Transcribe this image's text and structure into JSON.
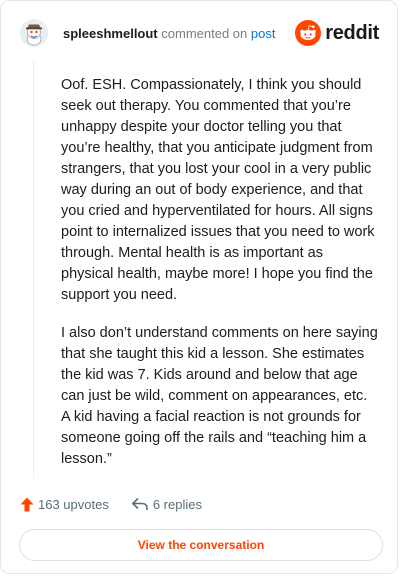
{
  "comment": {
    "username": "spleeshmellout",
    "action_text": "commented on",
    "target_link": "post",
    "paragraphs": [
      "Oof. ESH. Compassionately, I think you should seek out therapy. You commented that you’re unhappy despite your doctor telling you that you’re healthy, that you anticipate judgment from strangers, that you lost your cool in a very public way during an out of body experience, and that you cried and hyperventilated for hours. All signs point to internalized issues that you need to work through. Mental health is as important as physical health, maybe more! I hope you find the support you need.",
      "I also don’t understand comments on here saying that she taught this kid a lesson. She estimates the kid was 7. Kids around and below that age can just be wild, comment on appearances, etc. A kid having a facial reaction is not grounds for someone going off the rails and “teaching him a lesson.”"
    ]
  },
  "brand": {
    "wordmark": "reddit",
    "icon": "reddit-logo-icon",
    "color": "#ff4500"
  },
  "stats": {
    "upvotes_label": "163 upvotes",
    "replies_label": "6 replies",
    "upvote_icon": "upvote-arrow-icon",
    "reply_icon": "reply-arrow-icon"
  },
  "cta_label": "View the conversation"
}
